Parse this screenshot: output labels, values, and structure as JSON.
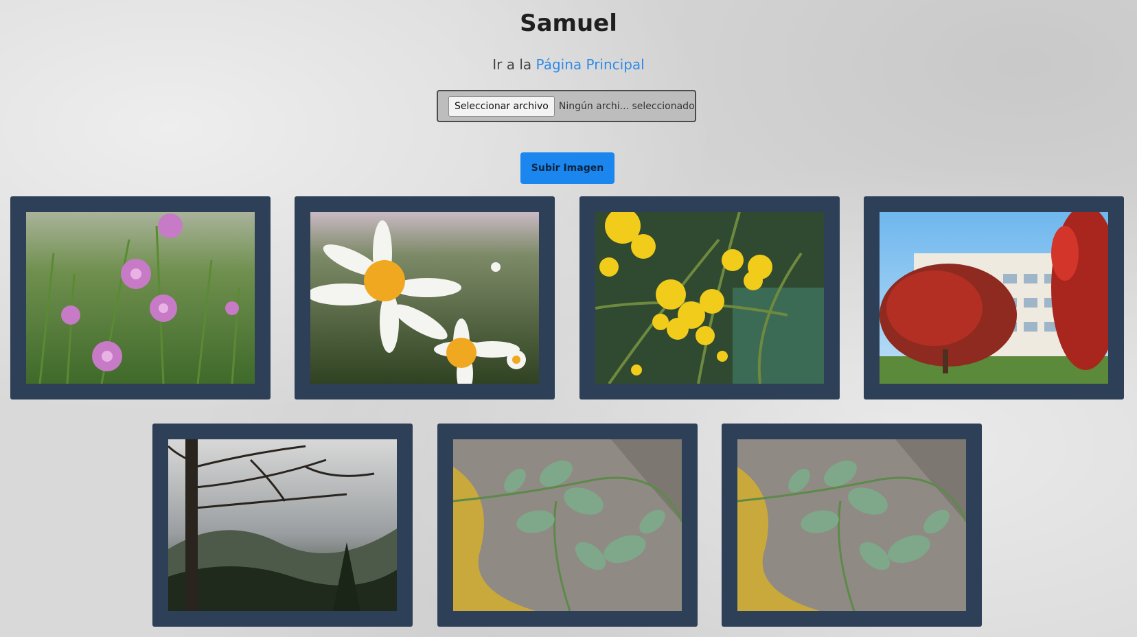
{
  "header": {
    "title": "Samuel"
  },
  "nav": {
    "prefix": "Ir a la ",
    "link_label": "Página Principal"
  },
  "upload": {
    "choose_button_label": "Seleccionar archivo",
    "no_file_text": "Ningún archi... seleccionado",
    "submit_label": "Subir Imagen"
  },
  "gallery": {
    "images": [
      {
        "subject": "pink wildflowers in grass"
      },
      {
        "subject": "white daisies in meadow"
      },
      {
        "subject": "yellow mimosa blossoms"
      },
      {
        "subject": "red bottlebrush tree and building"
      },
      {
        "subject": "misty forest and mountains"
      },
      {
        "subject": "green vine on stone"
      },
      {
        "subject": "green vine on stone"
      }
    ]
  },
  "colors": {
    "link": "#2f8ae8",
    "button": "#1a86ee",
    "card": "#2d4058"
  }
}
